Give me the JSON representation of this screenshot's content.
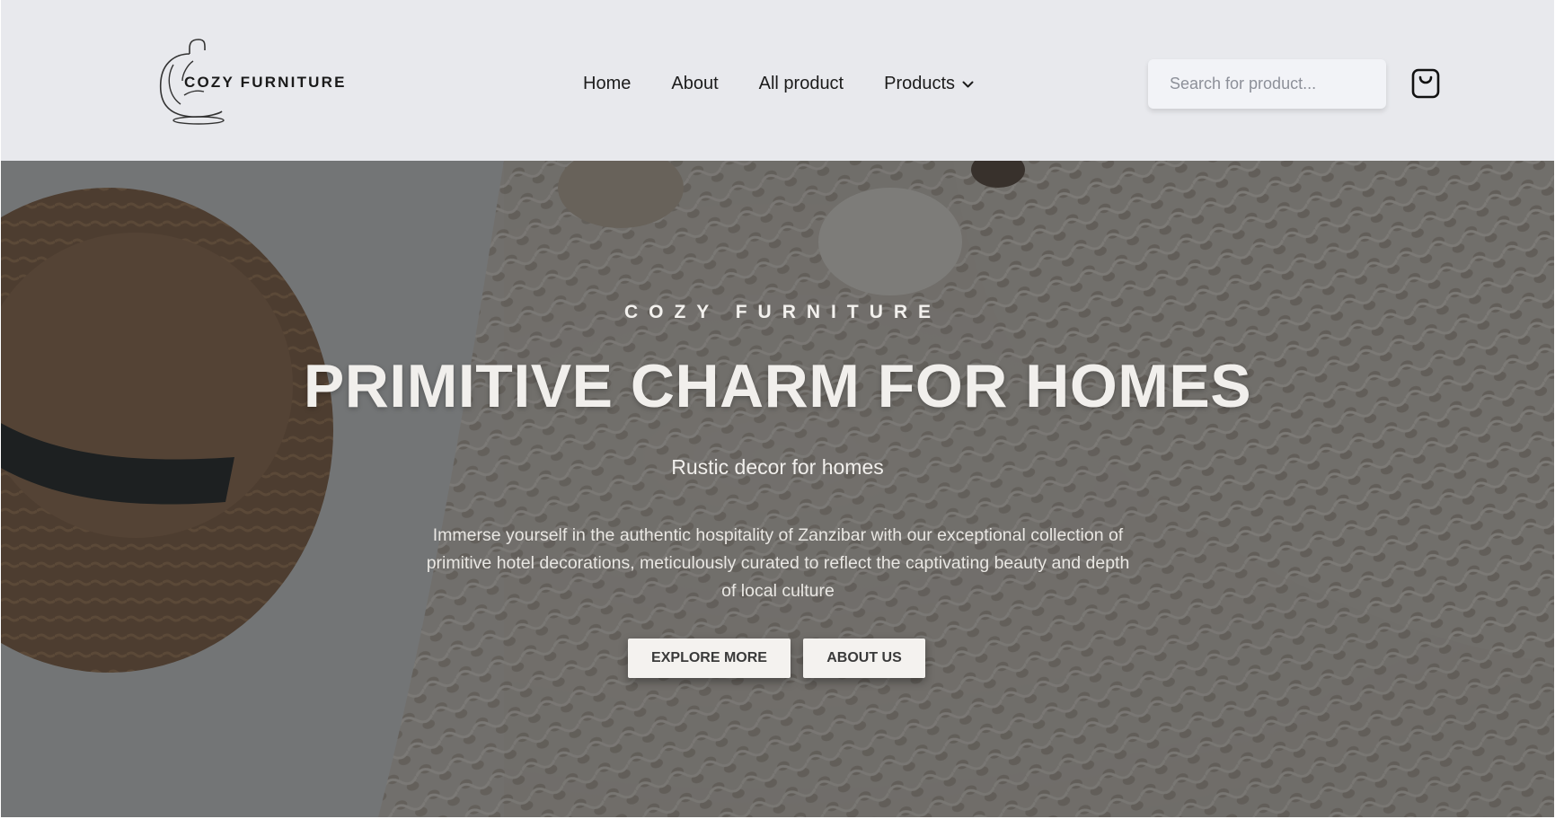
{
  "brand": {
    "name": "COZY FURNITURE",
    "logo_icon": "hanging-chair-logo"
  },
  "nav": {
    "items": [
      {
        "label": "Home"
      },
      {
        "label": "About"
      },
      {
        "label": "All product"
      },
      {
        "label": "Products",
        "has_dropdown": true
      }
    ]
  },
  "search": {
    "placeholder": "Search for product..."
  },
  "cart": {
    "icon": "shopping-bag-icon"
  },
  "hero": {
    "eyebrow": "COZY FURNITURE",
    "headline": "PRIMITIVE CHARM FOR HOMES",
    "subheadline": "Rustic decor for homes",
    "description": "Immerse yourself in the authentic hospitality of Zanzibar with our exceptional collection of primitive hotel decorations, meticulously curated to reflect the captivating beauty and depth of local culture",
    "buttons": {
      "explore": "EXPLORE MORE",
      "about": "ABOUT US"
    }
  },
  "colors": {
    "header_bg": "#e8e9ed",
    "text_dark": "#1c1c1c",
    "hero_text": "#f1efec",
    "button_bg": "#f4f2ef"
  }
}
